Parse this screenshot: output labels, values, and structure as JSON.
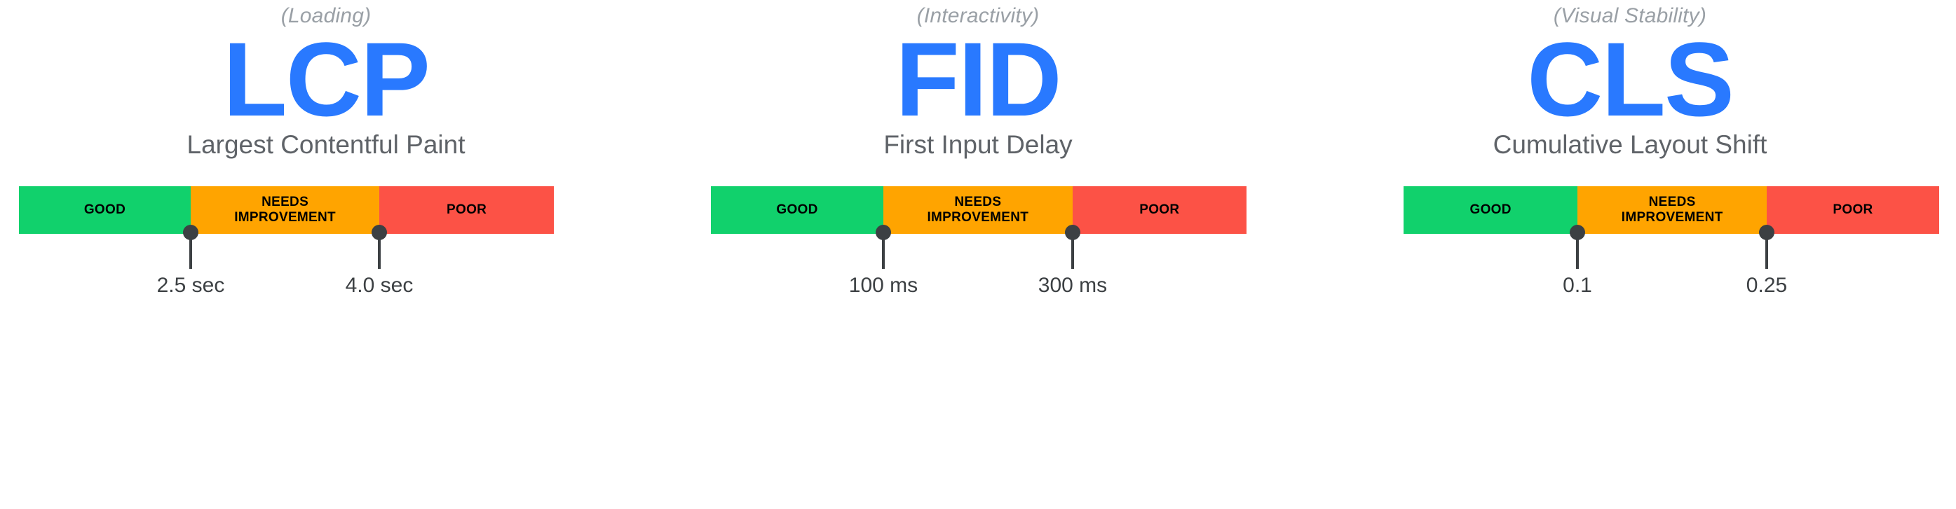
{
  "colors": {
    "good": "#11D16C",
    "needs_improvement": "#FFA400",
    "poor": "#FC5246",
    "accent_blue": "#2979FF",
    "text_gray": "#5F6368",
    "caption_gray": "#9AA0A6",
    "marker_dark": "#3C4043",
    "background": "#FFFFFF"
  },
  "segment_labels": {
    "good": "GOOD",
    "needs_improvement": "NEEDS\nIMPROVEMENT",
    "poor": "POOR"
  },
  "metrics": [
    {
      "category": "(Loading)",
      "acronym": "LCP",
      "fullname": "Largest Contentful Paint",
      "segments": [
        {
          "key": "good",
          "label": "GOOD",
          "width_pct": 32.1
        },
        {
          "key": "needs_improvement",
          "label": "NEEDS\nIMPROVEMENT",
          "width_pct": 35.3
        },
        {
          "key": "poor",
          "label": "POOR",
          "width_pct": 32.6
        }
      ],
      "thresholds": [
        {
          "label": "2.5 sec",
          "position_pct": 32.1
        },
        {
          "label": "4.0 sec",
          "position_pct": 67.4
        }
      ]
    },
    {
      "category": "(Interactivity)",
      "acronym": "FID",
      "fullname": "First Input Delay",
      "segments": [
        {
          "key": "good",
          "label": "GOOD",
          "width_pct": 32.2
        },
        {
          "key": "needs_improvement",
          "label": "NEEDS\nIMPROVEMENT",
          "width_pct": 35.3
        },
        {
          "key": "poor",
          "label": "POOR",
          "width_pct": 32.5
        }
      ],
      "thresholds": [
        {
          "label": "100 ms",
          "position_pct": 32.2
        },
        {
          "label": "300 ms",
          "position_pct": 67.5
        }
      ]
    },
    {
      "category": "(Visual Stability)",
      "acronym": "CLS",
      "fullname": "Cumulative Layout Shift",
      "segments": [
        {
          "key": "good",
          "label": "GOOD",
          "width_pct": 32.5
        },
        {
          "key": "needs_improvement",
          "label": "NEEDS\nIMPROVEMENT",
          "width_pct": 35.3
        },
        {
          "key": "poor",
          "label": "POOR",
          "width_pct": 32.2
        }
      ],
      "thresholds": [
        {
          "label": "0.1",
          "position_pct": 32.5
        },
        {
          "label": "0.25",
          "position_pct": 67.8
        }
      ]
    }
  ],
  "chart_data": {
    "type": "bar",
    "title": "Core Web Vitals thresholds",
    "xlabel": "",
    "ylabel": "",
    "categories": [
      "LCP",
      "FID",
      "CLS"
    ],
    "series": [
      {
        "name": "GOOD",
        "values": [
          "0 – 2.5 sec",
          "0 – 100 ms",
          "0 – 0.1"
        ]
      },
      {
        "name": "NEEDS IMPROVEMENT",
        "values": [
          "2.5 – 4.0 sec",
          "100 – 300 ms",
          "0.1 – 0.25"
        ]
      },
      {
        "name": "POOR",
        "values": [
          "> 4.0 sec",
          "> 300 ms",
          "> 0.25"
        ]
      }
    ],
    "annotations": [
      {
        "metric": "LCP",
        "thresholds": [
          "2.5 sec",
          "4.0 sec"
        ]
      },
      {
        "metric": "FID",
        "thresholds": [
          "100 ms",
          "300 ms"
        ]
      },
      {
        "metric": "CLS",
        "thresholds": [
          "0.1",
          "0.25"
        ]
      }
    ],
    "legend_position": "inline",
    "grid": false
  }
}
